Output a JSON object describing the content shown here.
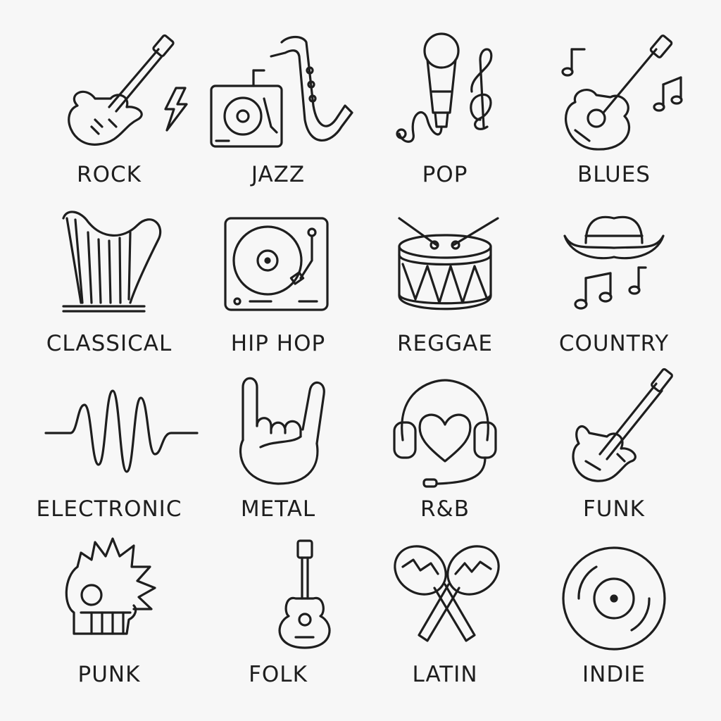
{
  "genres": [
    {
      "label": "ROCK",
      "icon": "electric-guitar-lightning-icon"
    },
    {
      "label": "JAZZ",
      "icon": "saxophone-turntable-icon"
    },
    {
      "label": "POP",
      "icon": "microphone-treble-clef-icon"
    },
    {
      "label": "BLUES",
      "icon": "acoustic-guitar-notes-icon"
    },
    {
      "label": "CLASSICAL",
      "icon": "harp-icon"
    },
    {
      "label": "HIP HOP",
      "icon": "turntable-icon"
    },
    {
      "label": "REGGAE",
      "icon": "drum-icon"
    },
    {
      "label": "COUNTRY",
      "icon": "cowboy-hat-notes-icon"
    },
    {
      "label": "ELECTRONIC",
      "icon": "sound-wave-icon"
    },
    {
      "label": "METAL",
      "icon": "rock-hand-icon"
    },
    {
      "label": "R&B",
      "icon": "headset-heart-icon"
    },
    {
      "label": "FUNK",
      "icon": "bass-guitar-icon"
    },
    {
      "label": "PUNK",
      "icon": "mohawk-skull-icon"
    },
    {
      "label": "FOLK",
      "icon": "ukulele-icon"
    },
    {
      "label": "LATIN",
      "icon": "maracas-icon"
    },
    {
      "label": "INDIE",
      "icon": "vinyl-record-icon"
    }
  ],
  "colors": {
    "background": "#f7f7f7",
    "stroke": "#1e1e1e"
  }
}
